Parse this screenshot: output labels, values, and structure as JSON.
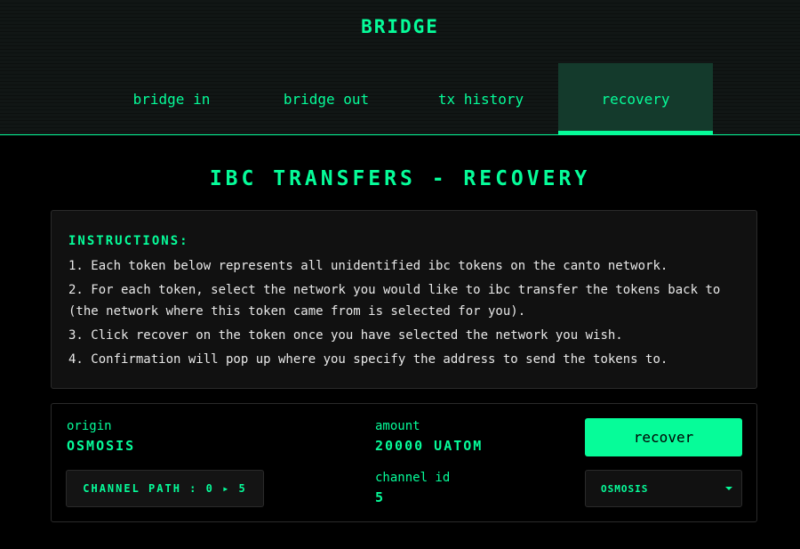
{
  "header": {
    "brand": "BRIDGE"
  },
  "tabs": [
    {
      "label": "bridge in",
      "active": false
    },
    {
      "label": "bridge out",
      "active": false
    },
    {
      "label": "tx history",
      "active": false
    },
    {
      "label": "recovery",
      "active": true
    }
  ],
  "page": {
    "title": "IBC TRANSFERS - RECOVERY"
  },
  "instructions": {
    "heading": "INSTRUCTIONS:",
    "steps": [
      "1. Each token below represents all unidentified ibc tokens on the canto network.",
      "2. For each token, select the network you would like to ibc transfer the tokens back to (the network where this token came from is selected for you).",
      "3. Click recover on the token once you have selected the network you wish.",
      "4. Confirmation will pop up where you specify the address to send the tokens to."
    ]
  },
  "token": {
    "origin_label": "origin",
    "origin_value": "OSMOSIS",
    "amount_label": "amount",
    "amount_value": "20000 UATOM",
    "recover_label": "recover",
    "channel_path_label": "CHANNEL PATH : 0 ▸ 5",
    "channel_id_label": "channel id",
    "channel_id_value": "5",
    "network_selected": "OSMOSIS"
  },
  "colors": {
    "accent": "#06fc99",
    "background": "#000000",
    "panel": "#111111",
    "active_tab": "#143a2c"
  },
  "icons": {
    "select_caret": "caret-down-icon"
  }
}
